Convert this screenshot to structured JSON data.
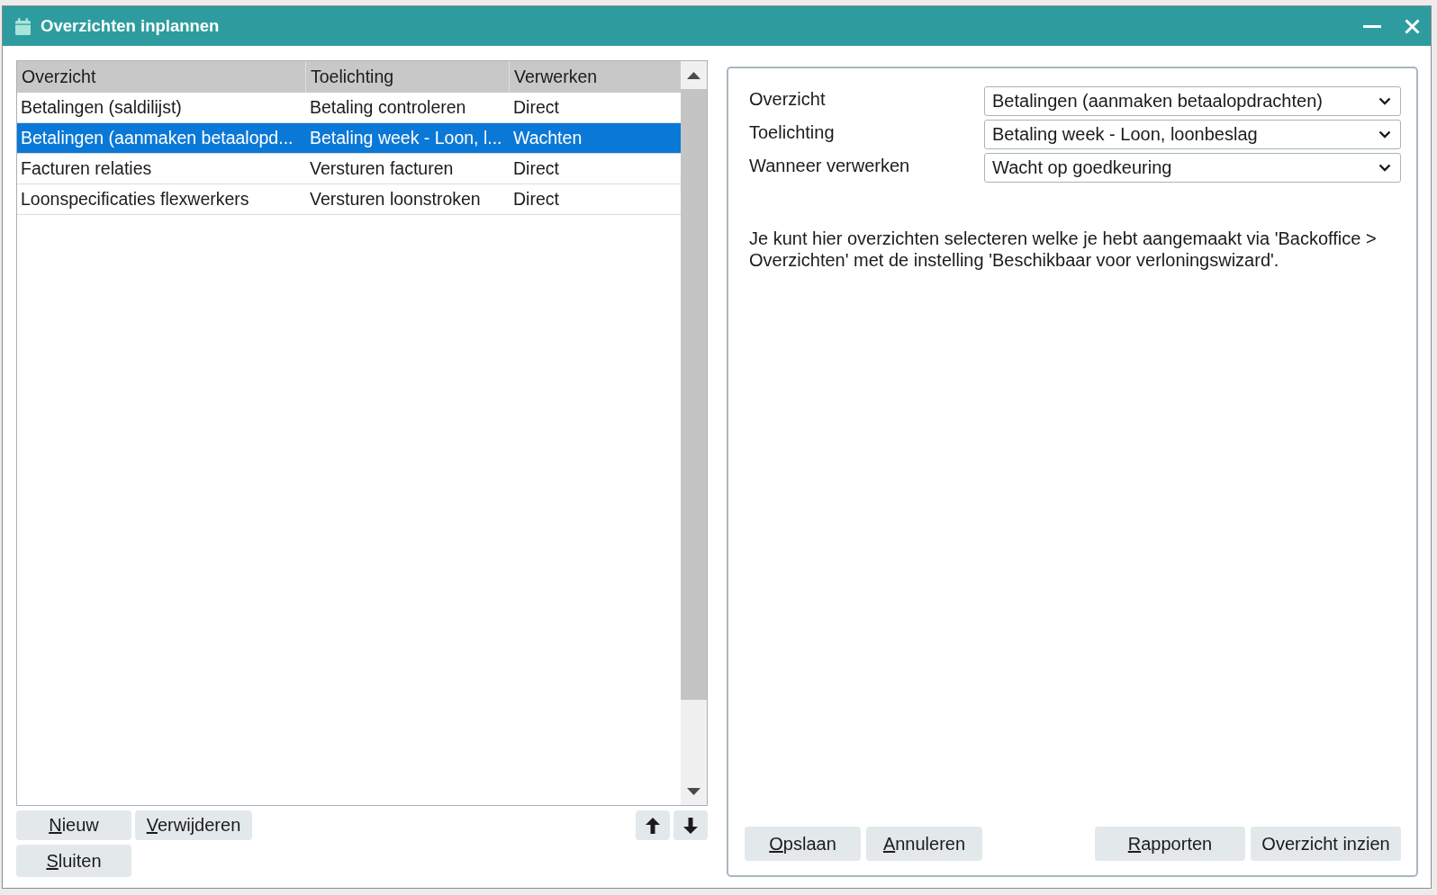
{
  "window": {
    "title": "Overzichten inplannen"
  },
  "table": {
    "columns": [
      "Overzicht",
      "Toelichting",
      "Verwerken"
    ],
    "rows": [
      {
        "cells": [
          "Betalingen (saldilijst)",
          "Betaling controleren",
          "Direct"
        ],
        "selected": false
      },
      {
        "cells": [
          "Betalingen (aanmaken betaalopd...",
          "Betaling week - Loon, l...",
          "Wachten"
        ],
        "selected": true
      },
      {
        "cells": [
          "Facturen relaties",
          "Versturen facturen",
          "Direct"
        ],
        "selected": false
      },
      {
        "cells": [
          "Loonspecificaties flexwerkers",
          "Versturen loonstroken",
          "Direct"
        ],
        "selected": false
      }
    ]
  },
  "list_buttons": [
    {
      "label": "Nieuw",
      "mnemonic": true
    },
    {
      "label": "Verwijderen",
      "mnemonic": true
    }
  ],
  "move_buttons": [
    {
      "kind": "up"
    },
    {
      "kind": "down"
    }
  ],
  "close_button": {
    "label": "Sluiten",
    "mnemonic": true
  },
  "form": {
    "fields": [
      {
        "label": "Overzicht",
        "value": "Betalingen (aanmaken betaalopdrachten)"
      },
      {
        "label": "Toelichting",
        "value": "Betaling week - Loon, loonbeslag"
      },
      {
        "label": "Wanneer verwerken",
        "value": "Wacht op goedkeuring"
      }
    ],
    "note": "Je kunt hier overzichten selecteren welke je hebt aangemaakt via 'Backoffice > Overzichten' met de instelling 'Beschikbaar voor verloningswizard'.",
    "buttons": [
      {
        "label": "Opslaan",
        "mnemonic": true
      },
      {
        "label": "Annuleren",
        "mnemonic": true
      }
    ],
    "extra_buttons": [
      {
        "label": "Rapporten",
        "mnemonic": true
      },
      {
        "label": "Overzicht inzien",
        "mnemonic": false
      }
    ]
  }
}
